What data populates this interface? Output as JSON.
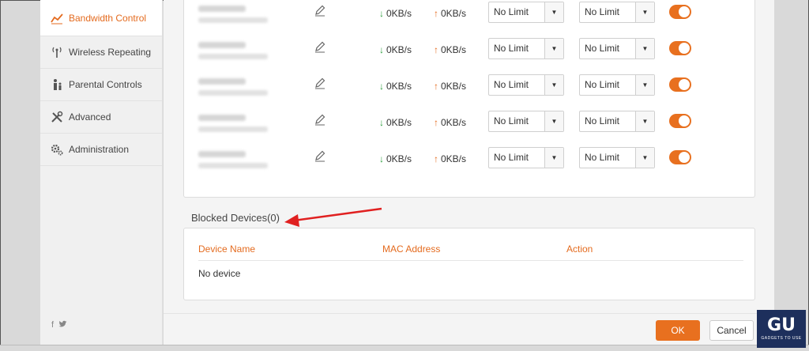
{
  "sidebar": {
    "items": [
      {
        "label": "Bandwidth Control",
        "icon": "chart-line-icon",
        "active": true
      },
      {
        "label": "Wireless Repeating",
        "icon": "antenna-icon",
        "active": false
      },
      {
        "label": "Parental Controls",
        "icon": "family-icon",
        "active": false
      },
      {
        "label": "Advanced",
        "icon": "tools-icon",
        "active": false
      },
      {
        "label": "Administration",
        "icon": "gears-icon",
        "active": false
      }
    ],
    "social": {
      "facebook": "f",
      "twitter": "t"
    }
  },
  "devices": [
    {
      "down": "0KB/s",
      "up": "0KB/s",
      "down_limit": "No Limit",
      "up_limit": "No Limit",
      "enabled": true
    },
    {
      "down": "0KB/s",
      "up": "0KB/s",
      "down_limit": "No Limit",
      "up_limit": "No Limit",
      "enabled": true
    },
    {
      "down": "0KB/s",
      "up": "0KB/s",
      "down_limit": "No Limit",
      "up_limit": "No Limit",
      "enabled": true
    },
    {
      "down": "0KB/s",
      "up": "0KB/s",
      "down_limit": "No Limit",
      "up_limit": "No Limit",
      "enabled": true
    },
    {
      "down": "0KB/s",
      "up": "0KB/s",
      "down_limit": "No Limit",
      "up_limit": "No Limit",
      "enabled": true
    }
  ],
  "blocked": {
    "title": "Blocked Devices(0)",
    "columns": [
      "Device Name",
      "MAC Address",
      "Action"
    ],
    "empty_text": "No device"
  },
  "footer": {
    "ok_label": "OK",
    "cancel_label": "Cancel"
  },
  "watermark": {
    "mark": "GU",
    "sub": "GADGETS TO USE"
  },
  "colors": {
    "accent": "#e8701f",
    "down_arrow": "#2a9d3b",
    "up_arrow": "#e46b1f",
    "annotation": "#e02020"
  }
}
